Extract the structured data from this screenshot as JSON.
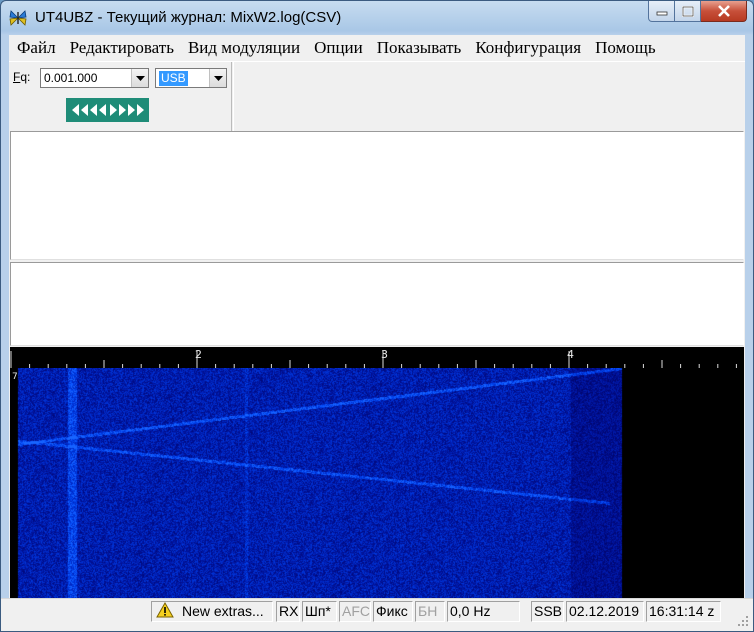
{
  "window": {
    "title": "UT4UBZ - Текущий журнал: MixW2.log(CSV)"
  },
  "menu": [
    "Файл",
    "Редактировать",
    "Вид модуляции",
    "Опции",
    "Показывать",
    "Конфигурация",
    "Помощь"
  ],
  "toolbar": {
    "freq_label_mnemonic": "F",
    "freq_label_rest": "q:",
    "freq_value": "0.001.000",
    "mode_value": "USB"
  },
  "waterfall": {
    "scale_labels": [
      "2",
      "3",
      "4"
    ],
    "left_marker": "7",
    "colors": {
      "background": "#000000",
      "signal": "#1e3cff"
    }
  },
  "status": {
    "message": "New extras...",
    "rx": "RX",
    "font": "Шп*",
    "afc": "AFC",
    "fix": "Фикс",
    "bn": "БН",
    "offset": "0,0 Hz",
    "mode": "SSB",
    "date": "02.12.2019",
    "time": "16:31:14 z"
  },
  "icons": [
    "app-butterfly-icon",
    "minimize-icon",
    "maximize-icon",
    "close-icon",
    "dropdown-arrow-icon",
    "warning-icon"
  ]
}
